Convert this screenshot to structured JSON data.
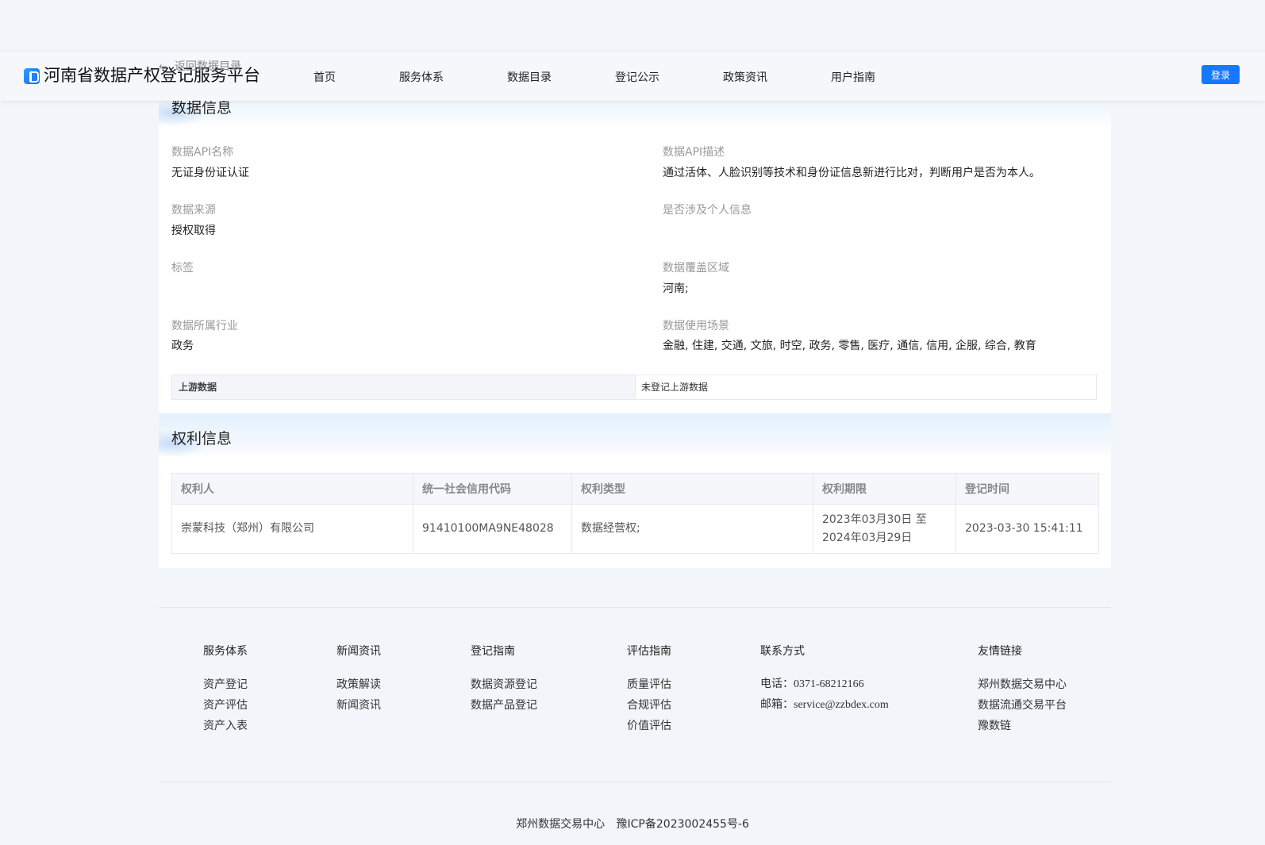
{
  "header": {
    "site_title": "河南省数据产权登记服务平台",
    "back_link": "返回数据目录",
    "nav": [
      "首页",
      "服务体系",
      "数据目录",
      "登记公示",
      "政策资讯",
      "用户指南"
    ],
    "login": "登录"
  },
  "data_info": {
    "title": "数据信息",
    "fields": [
      {
        "label": "数据API名称",
        "value": "无证身份证认证"
      },
      {
        "label": "数据API描述",
        "value": "通过活体、人脸识别等技术和身份证信息新进行比对，判断用户是否为本人。"
      },
      {
        "label": "数据来源",
        "value": "授权取得"
      },
      {
        "label": "是否涉及个人信息",
        "value": ""
      },
      {
        "label": "标签",
        "value": ""
      },
      {
        "label": "数据覆盖区域",
        "value": "河南;"
      },
      {
        "label": "数据所属行业",
        "value": "政务"
      },
      {
        "label": "数据使用场景",
        "value": "金融, 住建, 交通, 文旅, 时空, 政务, 零售, 医疗, 通信, 信用, 企服, 综合, 教育"
      }
    ],
    "upstream_label": "上游数据",
    "upstream_value": "未登记上游数据"
  },
  "rights_info": {
    "title": "权利信息",
    "columns": [
      "权利人",
      "统一社会信用代码",
      "权利类型",
      "权利期限",
      "登记时间"
    ],
    "rows": [
      [
        "崇蒙科技（郑州）有限公司",
        "91410100MA9NE48028",
        "数据经营权;",
        "2023年03月30日 至 2024年03月29日",
        "2023-03-30 15:41:11"
      ]
    ]
  },
  "footer": {
    "columns": [
      {
        "title": "服务体系",
        "items": [
          "资产登记",
          "资产评估",
          "资产入表"
        ]
      },
      {
        "title": "新闻资讯",
        "items": [
          "政策解读",
          "新闻资讯"
        ]
      },
      {
        "title": "登记指南",
        "items": [
          "数据资源登记",
          "数据产品登记"
        ]
      },
      {
        "title": "评估指南",
        "items": [
          "质量评估",
          "合规评估",
          "价值评估"
        ]
      },
      {
        "title": "联系方式",
        "items": [
          "电话：0371-68212166",
          "邮箱：service@zzbdex.com"
        ]
      },
      {
        "title": "友情链接",
        "items": [
          "郑州数据交易中心",
          "数据流通交易平台",
          "豫数链"
        ]
      }
    ],
    "org": "郑州数据交易中心",
    "icp": "豫ICP备2023002455号-6"
  }
}
